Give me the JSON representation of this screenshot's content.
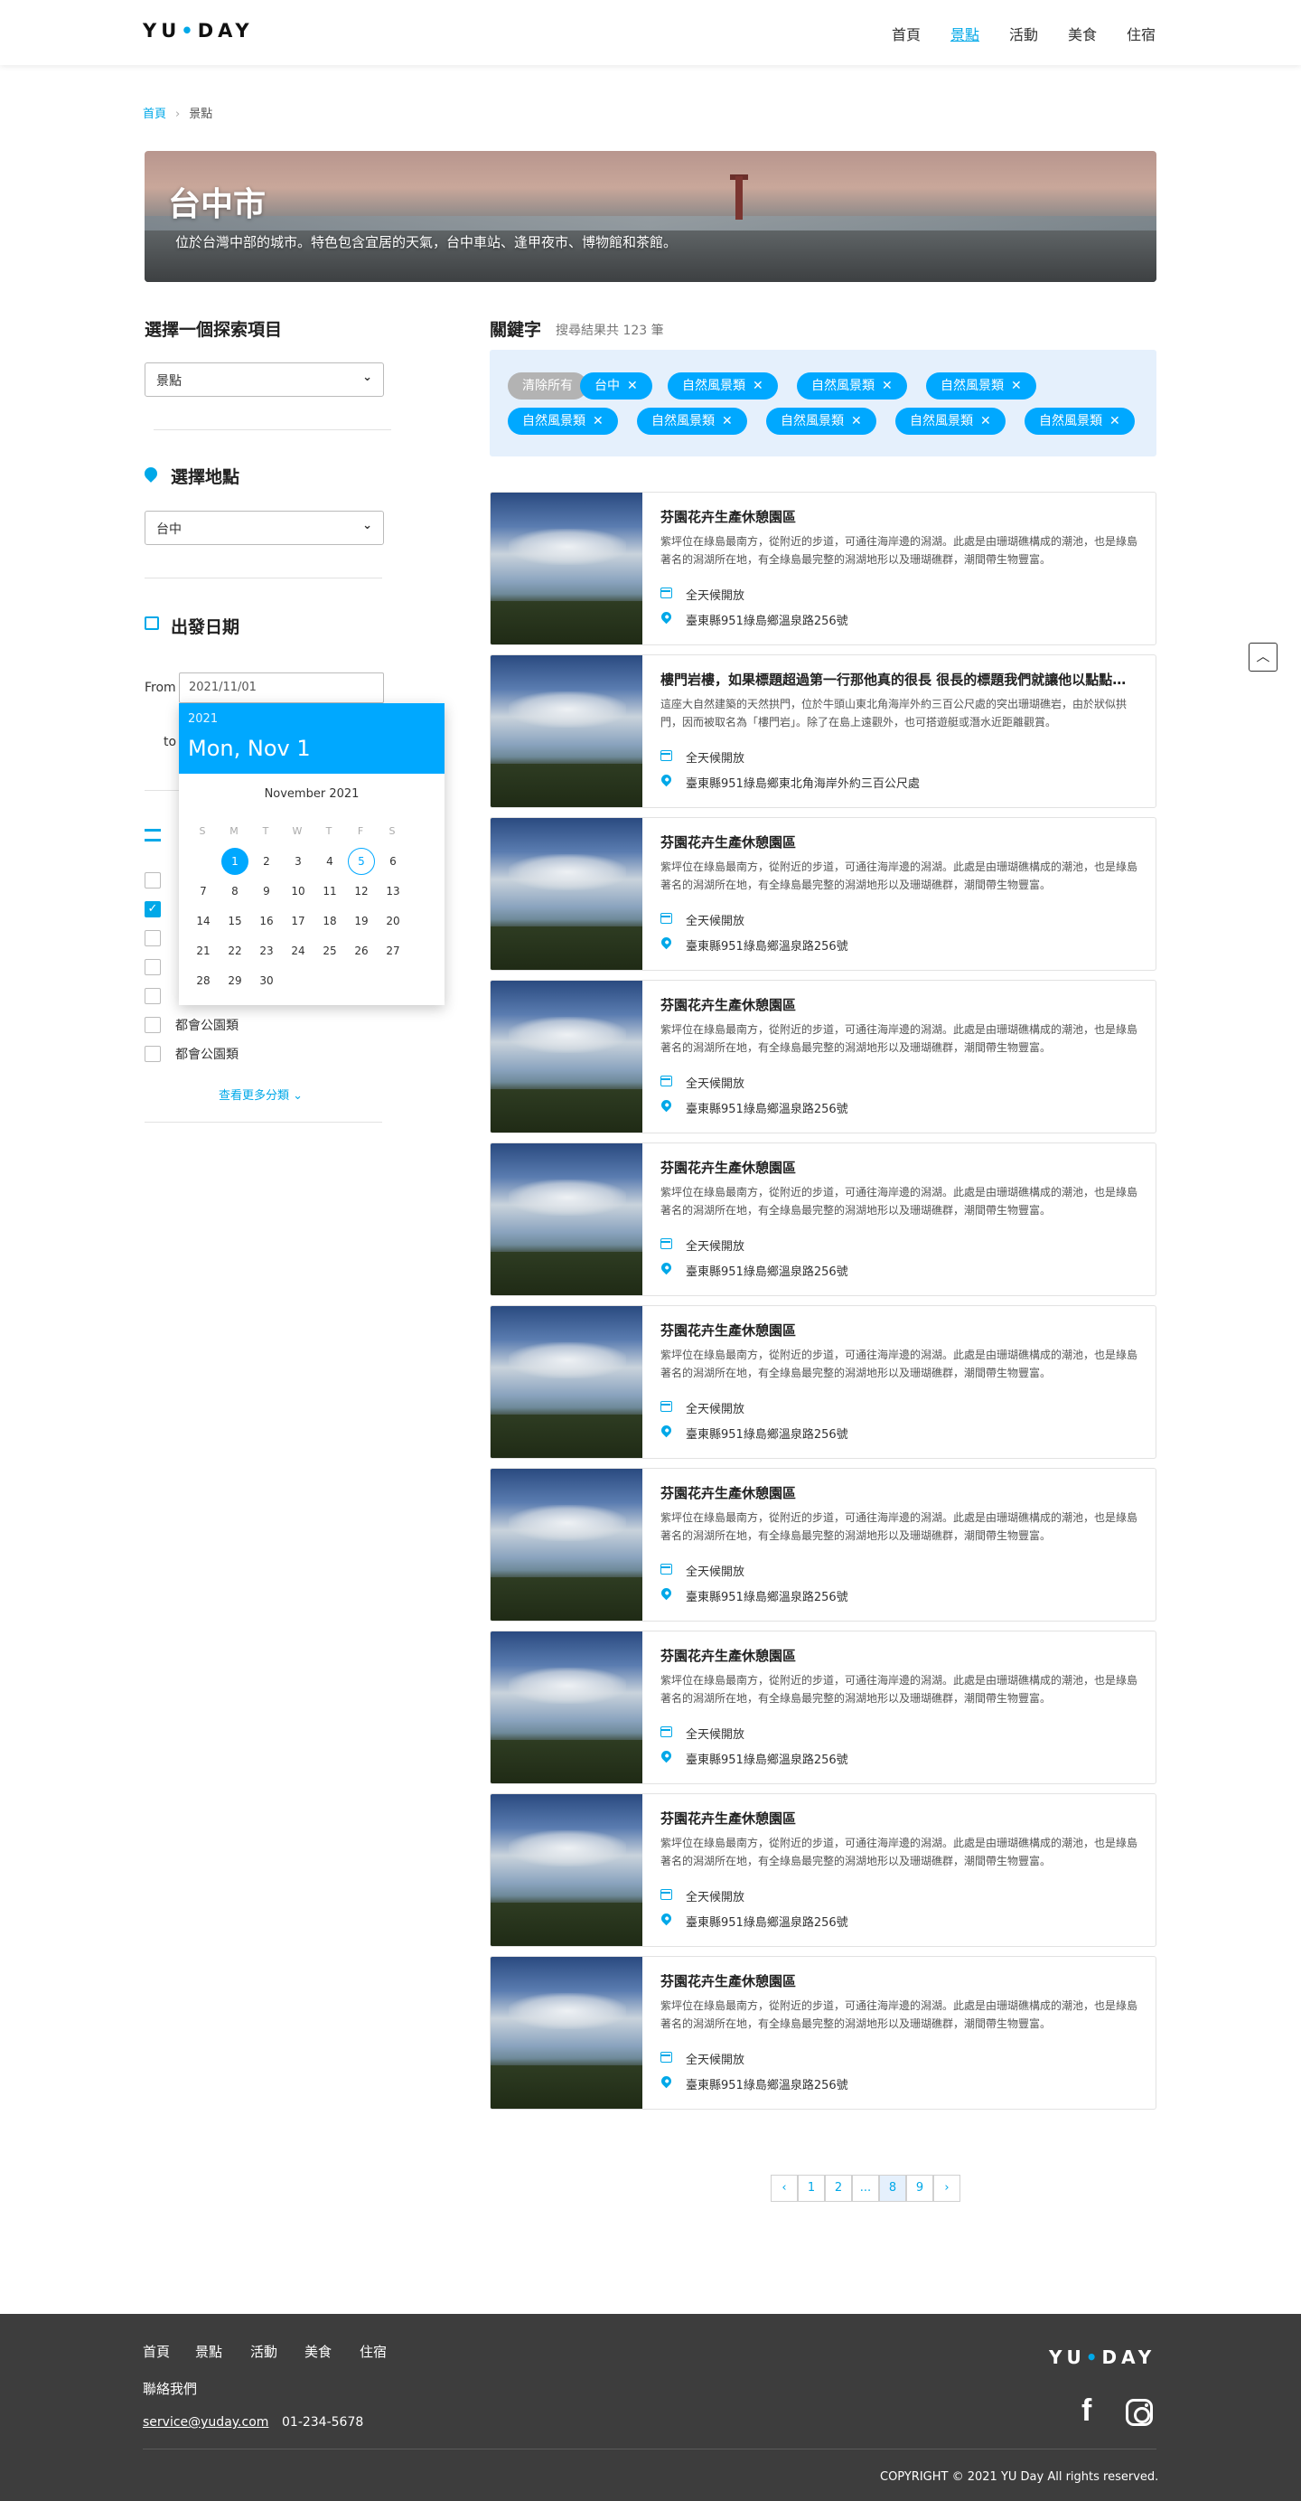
{
  "header": {
    "logo": {
      "left": "YU",
      "dot": "•",
      "right": "DAY"
    },
    "nav": [
      {
        "label": "首頁"
      },
      {
        "label": "景點",
        "active": true
      },
      {
        "label": "活動"
      },
      {
        "label": "美食"
      },
      {
        "label": "住宿"
      }
    ]
  },
  "breadcrumb": {
    "home": "首頁",
    "sep": "›",
    "current": "景點"
  },
  "hero": {
    "title": "台中市",
    "desc": "位於台灣中部的城市。特色包含宜居的天氣，台中車站、逢甲夜市、博物館和茶館。"
  },
  "sidebar": {
    "category_title": "選擇一個探索項目",
    "category_value": "景點",
    "location_title": "選擇地點",
    "location_value": "台中",
    "date_title": "出發日期",
    "from_label": "From",
    "from_value": "2021/11/01",
    "to_label": "to",
    "checkboxes": [
      {
        "label": "",
        "checked": false
      },
      {
        "label": "",
        "checked": true
      },
      {
        "label": "",
        "checked": false
      },
      {
        "label": "",
        "checked": false
      },
      {
        "label": "",
        "checked": false
      },
      {
        "label": "都會公園類",
        "checked": false
      },
      {
        "label": "都會公園類",
        "checked": false
      }
    ],
    "more_link": "查看更多分類"
  },
  "calendar": {
    "year": "2021",
    "selected_label": "Mon, Nov 1",
    "month_label": "November 2021",
    "dow": [
      "S",
      "M",
      "T",
      "W",
      "T",
      "F",
      "S"
    ],
    "days": [
      "1",
      "2",
      "3",
      "4",
      "5",
      "6",
      "7",
      "8",
      "9",
      "10",
      "11",
      "12",
      "13",
      "14",
      "15",
      "16",
      "17",
      "18",
      "19",
      "20",
      "21",
      "22",
      "23",
      "24",
      "25",
      "26",
      "27",
      "28",
      "29",
      "30"
    ],
    "selected_day": 1,
    "today_day": 5
  },
  "keywords": {
    "title": "關鍵字",
    "count": "搜尋結果共 123 筆",
    "clear_label": "清除所有",
    "close_glyph": "✕",
    "tags": [
      "台中",
      "自然風景類",
      "自然風景類",
      "自然風景類",
      "自然風景類",
      "自然風景類",
      "自然風景類",
      "自然風景類",
      "自然風景類"
    ]
  },
  "results": [
    {
      "title": "芬園花卉生產休憩園區",
      "desc": "紫坪位在綠島最南方，從附近的步道，可通往海岸邊的潟湖。此處是由珊瑚礁構成的潮池，也是綠島著名的潟湖所在地，有全綠島最完整的潟湖地形以及珊瑚礁群，潮間帶生物豐富。",
      "hours": "全天候開放",
      "address": "臺東縣951綠島鄉溫泉路256號"
    },
    {
      "title": "樓門岩樓，如果標題超過第一行那他真的很長 很長的標題我們就讓他以點點點的方式顯示",
      "desc": "這座大自然建築的天然拱門，位於牛頭山東北角海岸外約三百公尺處的突出珊瑚礁岩，由於狀似拱門，因而被取名為「樓門岩」。除了在島上遠觀外，也可搭遊艇或潛水近距離觀賞。",
      "hours": "全天候開放",
      "address": "臺東縣951綠島鄉東北角海岸外約三百公尺處"
    },
    {
      "title": "芬園花卉生產休憩園區",
      "desc": "紫坪位在綠島最南方，從附近的步道，可通往海岸邊的潟湖。此處是由珊瑚礁構成的潮池，也是綠島著名的潟湖所在地，有全綠島最完整的潟湖地形以及珊瑚礁群，潮間帶生物豐富。",
      "hours": "全天候開放",
      "address": "臺東縣951綠島鄉溫泉路256號"
    },
    {
      "title": "芬園花卉生產休憩園區",
      "desc": "紫坪位在綠島最南方，從附近的步道，可通往海岸邊的潟湖。此處是由珊瑚礁構成的潮池，也是綠島著名的潟湖所在地，有全綠島最完整的潟湖地形以及珊瑚礁群，潮間帶生物豐富。",
      "hours": "全天候開放",
      "address": "臺東縣951綠島鄉溫泉路256號"
    },
    {
      "title": "芬園花卉生產休憩園區",
      "desc": "紫坪位在綠島最南方，從附近的步道，可通往海岸邊的潟湖。此處是由珊瑚礁構成的潮池，也是綠島著名的潟湖所在地，有全綠島最完整的潟湖地形以及珊瑚礁群，潮間帶生物豐富。",
      "hours": "全天候開放",
      "address": "臺東縣951綠島鄉溫泉路256號"
    },
    {
      "title": "芬園花卉生產休憩園區",
      "desc": "紫坪位在綠島最南方，從附近的步道，可通往海岸邊的潟湖。此處是由珊瑚礁構成的潮池，也是綠島著名的潟湖所在地，有全綠島最完整的潟湖地形以及珊瑚礁群，潮間帶生物豐富。",
      "hours": "全天候開放",
      "address": "臺東縣951綠島鄉溫泉路256號"
    },
    {
      "title": "芬園花卉生產休憩園區",
      "desc": "紫坪位在綠島最南方，從附近的步道，可通往海岸邊的潟湖。此處是由珊瑚礁構成的潮池，也是綠島著名的潟湖所在地，有全綠島最完整的潟湖地形以及珊瑚礁群，潮間帶生物豐富。",
      "hours": "全天候開放",
      "address": "臺東縣951綠島鄉溫泉路256號"
    },
    {
      "title": "芬園花卉生產休憩園區",
      "desc": "紫坪位在綠島最南方，從附近的步道，可通往海岸邊的潟湖。此處是由珊瑚礁構成的潮池，也是綠島著名的潟湖所在地，有全綠島最完整的潟湖地形以及珊瑚礁群，潮間帶生物豐富。",
      "hours": "全天候開放",
      "address": "臺東縣951綠島鄉溫泉路256號"
    },
    {
      "title": "芬園花卉生產休憩園區",
      "desc": "紫坪位在綠島最南方，從附近的步道，可通往海岸邊的潟湖。此處是由珊瑚礁構成的潮池，也是綠島著名的潟湖所在地，有全綠島最完整的潟湖地形以及珊瑚礁群，潮間帶生物豐富。",
      "hours": "全天候開放",
      "address": "臺東縣951綠島鄉溫泉路256號"
    },
    {
      "title": "芬園花卉生產休憩園區",
      "desc": "紫坪位在綠島最南方，從附近的步道，可通往海岸邊的潟湖。此處是由珊瑚礁構成的潮池，也是綠島著名的潟湖所在地，有全綠島最完整的潟湖地形以及珊瑚礁群，潮間帶生物豐富。",
      "hours": "全天候開放",
      "address": "臺東縣951綠島鄉溫泉路256號"
    }
  ],
  "pagination": {
    "prev": "‹",
    "pages": [
      "1",
      "2",
      "...",
      "8",
      "9"
    ],
    "active": "8",
    "next": "›"
  },
  "scroll_top": "︿",
  "footer": {
    "nav": [
      "首頁",
      "景點",
      "活動",
      "美食",
      "住宿"
    ],
    "contact_title": "聯絡我們",
    "email": "service@yuday.com",
    "phone": "01-234-5678",
    "logo": {
      "left": "YU",
      "dot": "•",
      "right": "DAY"
    },
    "facebook_glyph": "f",
    "copyright": "COPYRIGHT © 2021 YU Day All rights reserved."
  },
  "colors": {
    "primary": "#00a8e8",
    "tag": "#00a8ff",
    "keyword_bg": "#e5f0fc",
    "footer_bg": "#3d3d3d"
  }
}
